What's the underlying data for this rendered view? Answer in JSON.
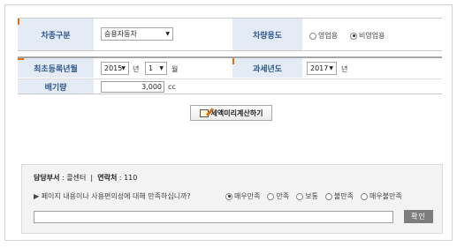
{
  "form": {
    "car_type": {
      "label": "차종구분",
      "value": "승용자동차"
    },
    "car_use": {
      "label": "차량용도",
      "options": [
        {
          "label": "영업용",
          "checked": false
        },
        {
          "label": "비영업용",
          "checked": true
        }
      ]
    },
    "first_reg": {
      "label": "최초등록년월",
      "year": "2015",
      "year_unit": "년",
      "month": "1",
      "month_unit": "월"
    },
    "tax_year": {
      "label": "과세년도",
      "year": "2017",
      "year_unit": "년"
    },
    "displacement": {
      "label": "배기량",
      "value": "3,000",
      "unit": "cc"
    }
  },
  "calculate_button": "세액미리계산하기",
  "survey": {
    "dept_label": "담당부서",
    "dept_value": "콜센터",
    "separator": "|",
    "phone_label": "연락처",
    "phone_value": "110",
    "question": "▶ 페이지 내용이나 사용편의성에 대해 만족하십니까?",
    "options": [
      {
        "label": "매우만족",
        "checked": true
      },
      {
        "label": "만족",
        "checked": false
      },
      {
        "label": "보통",
        "checked": false
      },
      {
        "label": "불만족",
        "checked": false
      },
      {
        "label": "매우불만족",
        "checked": false
      }
    ],
    "submit": "확인"
  }
}
